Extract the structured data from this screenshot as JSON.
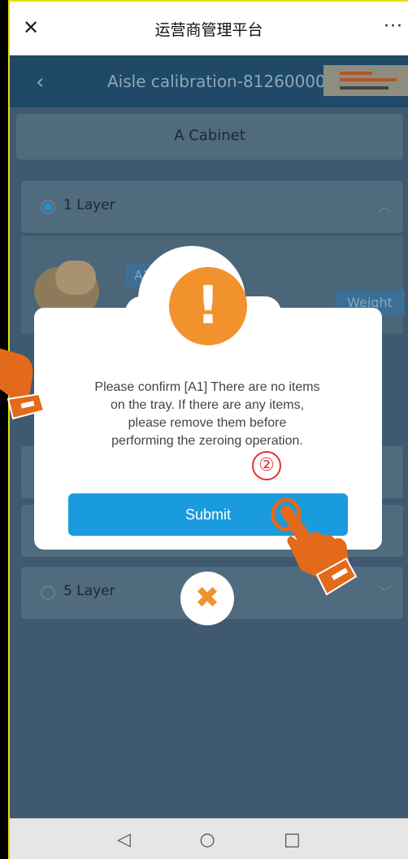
{
  "wechat_bar": {
    "close_glyph": "✕",
    "title": "运营商管理平台",
    "more_glyph": "···"
  },
  "header": {
    "back_glyph": "‹",
    "title": "Aisle calibration-81260000"
  },
  "cabinet": {
    "label": "A Cabinet"
  },
  "layers": [
    {
      "label": "1 Layer",
      "selected": true
    },
    {
      "label": "5 Layer",
      "selected": false
    }
  ],
  "item": {
    "slot_tag": "A1",
    "weight_button": "Weight"
  },
  "dialog": {
    "icon": "warning-icon",
    "message_lines": [
      "Please confirm [A1] There are no items",
      "on the tray. If there are any items,",
      "please remove them before",
      "performing the zeroing operation."
    ],
    "step_marker": "②",
    "submit_label": "Submit",
    "close_icon": "✖"
  },
  "nav": {
    "back": "◁",
    "home": "○",
    "recent": "□"
  },
  "colors": {
    "accent": "#1a9bde",
    "warning": "#f2922d",
    "marker": "#e53030",
    "hand": "#e36a1a"
  }
}
